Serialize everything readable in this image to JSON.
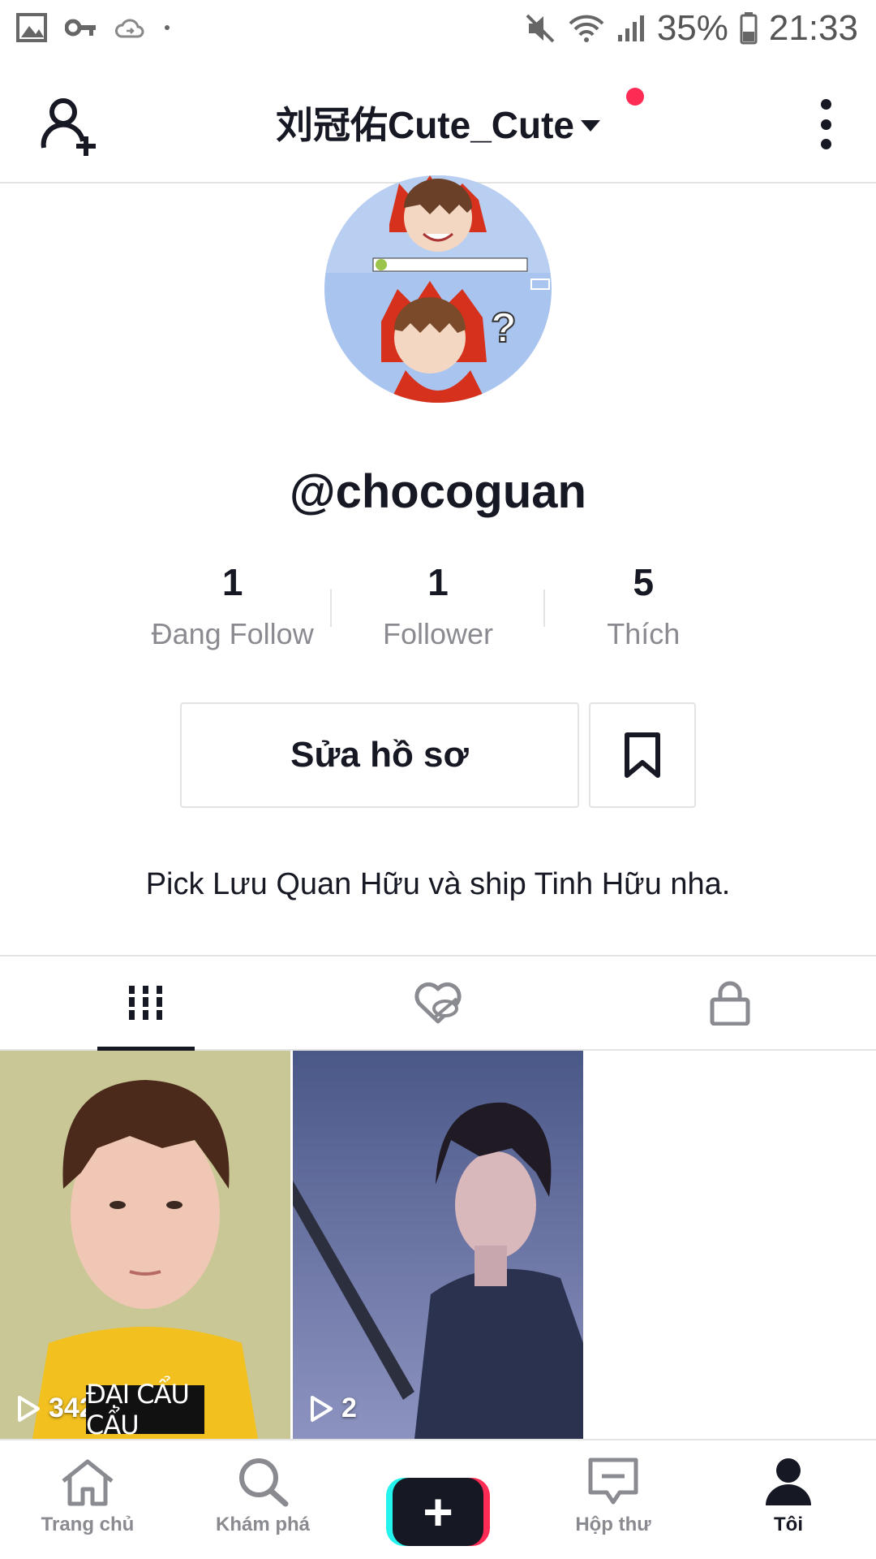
{
  "status_bar": {
    "battery": "35%",
    "time": "21:33",
    "icons": [
      "image-icon",
      "key-icon",
      "cloud-sync-icon",
      "dot-icon",
      "mute-icon",
      "wifi-icon",
      "signal-icon",
      "battery-icon"
    ]
  },
  "header": {
    "title": "刘冠佑Cute_Cute",
    "notification_dot_color": "#fe2c55"
  },
  "profile": {
    "username": "@chocoguan",
    "stats": [
      {
        "value": "1",
        "label": "Đang Follow"
      },
      {
        "value": "1",
        "label": "Follower"
      },
      {
        "value": "5",
        "label": "Thích"
      }
    ],
    "edit_button": "Sửa hồ sơ",
    "bio": "Pick Lưu Quan Hữu và ship Tinh Hữu nha."
  },
  "tabs": [
    {
      "name": "videos",
      "icon": "grid-icon",
      "active": true
    },
    {
      "name": "liked",
      "icon": "hidden-heart-icon",
      "active": false
    },
    {
      "name": "private",
      "icon": "lock-icon",
      "active": false
    }
  ],
  "videos": [
    {
      "views": "342",
      "caption": "ĐẠI CẨU CẨU"
    },
    {
      "views": "2",
      "caption": ""
    }
  ],
  "bottom_nav": [
    {
      "label": "Trang chủ",
      "icon": "home-icon",
      "active": false
    },
    {
      "label": "Khám phá",
      "icon": "search-icon",
      "active": false
    },
    {
      "label": "",
      "icon": "plus-icon",
      "active": false
    },
    {
      "label": "Hộp thư",
      "icon": "inbox-icon",
      "active": false
    },
    {
      "label": "Tôi",
      "icon": "profile-icon",
      "active": true
    }
  ],
  "colors": {
    "accent": "#fe2c55",
    "accent_cyan": "#25f4ee",
    "text_primary": "#161823",
    "text_secondary": "#8a8b91",
    "border": "#e3e3e4"
  }
}
